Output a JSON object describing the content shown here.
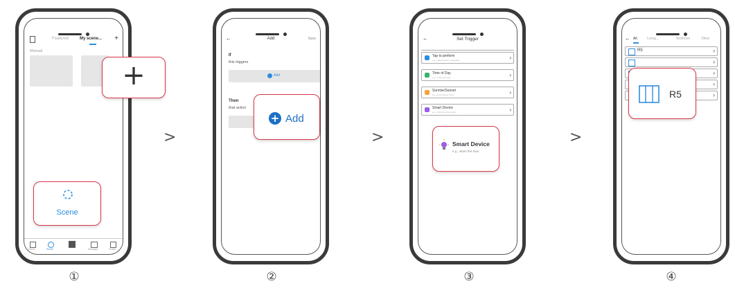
{
  "steps": [
    "①",
    "②",
    "③",
    "④"
  ],
  "arrows": [
    ">",
    ">",
    ">"
  ],
  "phone1": {
    "tabs": [
      "Featured",
      "My scene..."
    ],
    "plus": "+",
    "section": "Manual",
    "callout_plus": "+",
    "callout_scene": "Scene",
    "bottom_nav": [
      "Home",
      "Scene",
      "",
      "Message",
      "Profile"
    ]
  },
  "phone2": {
    "back": "←",
    "title": "Add",
    "save": "Save",
    "if_label": "If",
    "if_sub": "this triggers",
    "add_small": "Add",
    "then_label": "Then",
    "then_sub": "that action",
    "callout_add": "Add"
  },
  "phone3": {
    "back": "←",
    "title": "Set Trigger",
    "rows": [
      {
        "title": "Tap to perform",
        "sub": "e.g., when device is activated",
        "color": "#2d8de0"
      },
      {
        "title": "Time of Day",
        "sub": "e.g., 7:00 every day",
        "color": "#3ab26f"
      },
      {
        "title": "Sunrise/Sunset",
        "sub": "e.g., at sunrise at home",
        "color": "#f3a33a"
      },
      {
        "title": "Smart Device",
        "sub": "e.g., when the door opens",
        "color": "#9b5de5"
      }
    ],
    "callout_title": "Smart Device",
    "callout_sub": "e.g., when the door"
  },
  "phone4": {
    "back": "←",
    "tabs": [
      "All",
      "Living...",
      "Bedroom",
      "Other"
    ],
    "rows": [
      "R5",
      "",
      "",
      "",
      "S-CAM"
    ],
    "callout_label": "R5"
  },
  "colors": {
    "accent": "#2d8de0",
    "callout_border": "#d8364a"
  }
}
